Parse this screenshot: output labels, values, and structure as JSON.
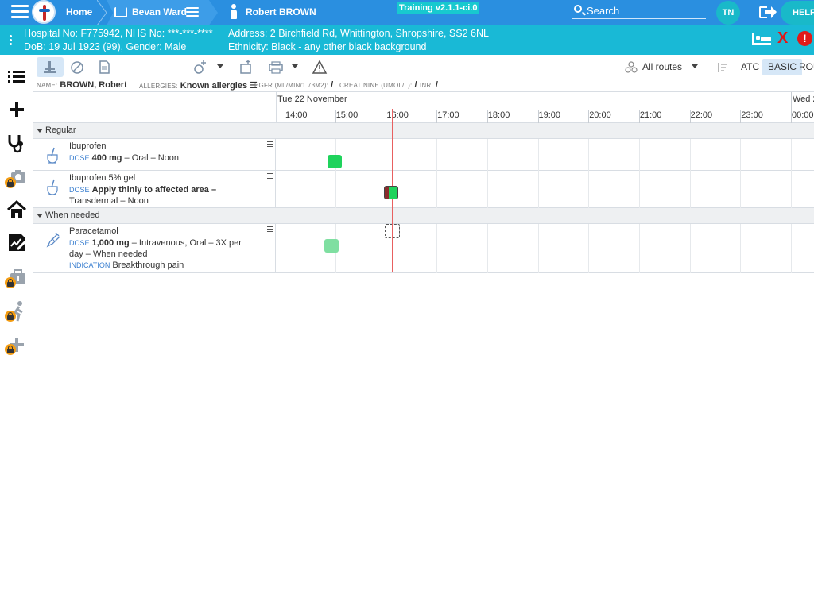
{
  "topbar": {
    "home_label": "Home",
    "ward_label": "Bevan Ward",
    "patient_label": "Robert BROWN",
    "environment": "Training v2.1.1-ci.0",
    "search_placeholder": "Search",
    "user_initials": "TN",
    "help_label": "HELP",
    "accent_color": "#2a8fe0"
  },
  "banner": {
    "line1_left": "Hospital No: F775942, NHS No: ***-***-****",
    "line2_left": "DoB: 19 Jul 1923 (99), Gender: Male",
    "line1_right": "Address: 2 Birchfield Rd, Whittington, Shropshire, SS2 6NL",
    "line2_right": "Ethnicity: Black - any other black background",
    "deceased_mark": "X",
    "alert_mark": "!",
    "color": "#19b9d6"
  },
  "rail": {
    "items": [
      "list-icon",
      "plus-icon",
      "stethoscope-icon",
      "camera-icon",
      "home-icon",
      "chart-doc-icon",
      "briefcase-icon",
      "walking-icon",
      "plus-gray-icon"
    ]
  },
  "toolbar": {
    "routes_label": "All routes",
    "atc_label": "ATC",
    "basic_label": "BASIC",
    "route_label": "ROU"
  },
  "info": {
    "name_key": "NAME:",
    "name_val": "BROWN, Robert",
    "allergies_key": "ALLERGIES:",
    "allergies_val": "Known allergies",
    "egfr_key": "EGFR (ML/MIN/1.73M2):",
    "egfr_val": "/",
    "creat_key": "CREATININE (UMOL/L):",
    "creat_val": "/",
    "inr_key": "INR:",
    "inr_val": "/"
  },
  "timeline": {
    "day1": "Tue 22 November",
    "day2": "Wed 2",
    "hours": [
      "14:00",
      "15:00",
      "16:00",
      "17:00",
      "18:00",
      "19:00",
      "20:00",
      "21:00",
      "22:00",
      "23:00",
      "00:00"
    ]
  },
  "groups": {
    "regular": "Regular",
    "when_needed": "When needed"
  },
  "meds": [
    {
      "name": "Ibuprofen",
      "dose_label": "DOSE",
      "dose_strong": "400 mg",
      "dose_rest": " – Oral – Noon"
    },
    {
      "name": "Ibuprofen 5% gel",
      "dose_label": "DOSE",
      "dose_strong": "Apply thinly to affected area –",
      "dose_rest": " Transdermal – Noon"
    },
    {
      "name": "Paracetamol",
      "dose_label": "DOSE",
      "dose_strong": "1,000 mg",
      "dose_rest": " – Intravenous, Oral – 3X per day – When needed",
      "indication_label": "INDICATION",
      "indication": "Breakthrough pain",
      "add_mark": "+"
    }
  ],
  "colors": {
    "given": "#1fd35c",
    "prn_given": "#7fdfa1",
    "late": "#c0392b",
    "now_line": "#e86060"
  }
}
